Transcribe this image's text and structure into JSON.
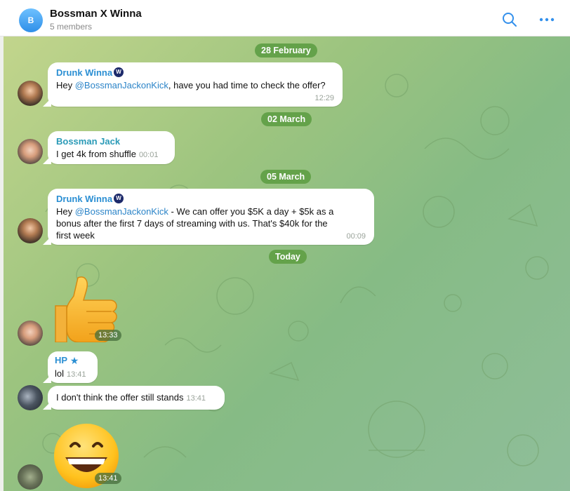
{
  "header": {
    "avatar_letter": "B",
    "title": "Bossman X Winna",
    "subtitle": "5 members",
    "search_icon": "search-icon",
    "more_icon": "more-icon"
  },
  "dates": {
    "feb": "28 February",
    "mar02": "02 March",
    "mar05": "05 March",
    "today": "Today"
  },
  "messages": {
    "m1": {
      "sender": "Drunk Winna",
      "text_pre": "Hey ",
      "mention": "@BossmanJackonKick",
      "text_post": ", have you had time to check the offer?",
      "time": "12:29"
    },
    "m2": {
      "sender": "Bossman Jack",
      "text": "I get 4k from shuffle",
      "time": "00:01"
    },
    "m3": {
      "sender": "Drunk Winna",
      "text_pre": "Hey ",
      "mention": "@BossmanJackonKick",
      "text_post": " - We can offer you $5K a day + $5k as a bonus after the first 7 days of streaming with us. That's $40k for the first week",
      "time": "00:09"
    },
    "m4": {
      "sticker": "thumbs-up",
      "time": "13:33"
    },
    "m5": {
      "sender": "HP",
      "text": "lol",
      "time": "13:41"
    },
    "m6": {
      "text": "I don't think the offer still stands",
      "time": "13:41"
    },
    "m7": {
      "sticker": "grinning-face",
      "time": "13:41"
    }
  },
  "colors": {
    "accent": "#2b8fd3",
    "date_pill": "#64a24a",
    "chat_bg_start": "#c2d58c",
    "chat_bg_end": "#8fbe9a"
  }
}
